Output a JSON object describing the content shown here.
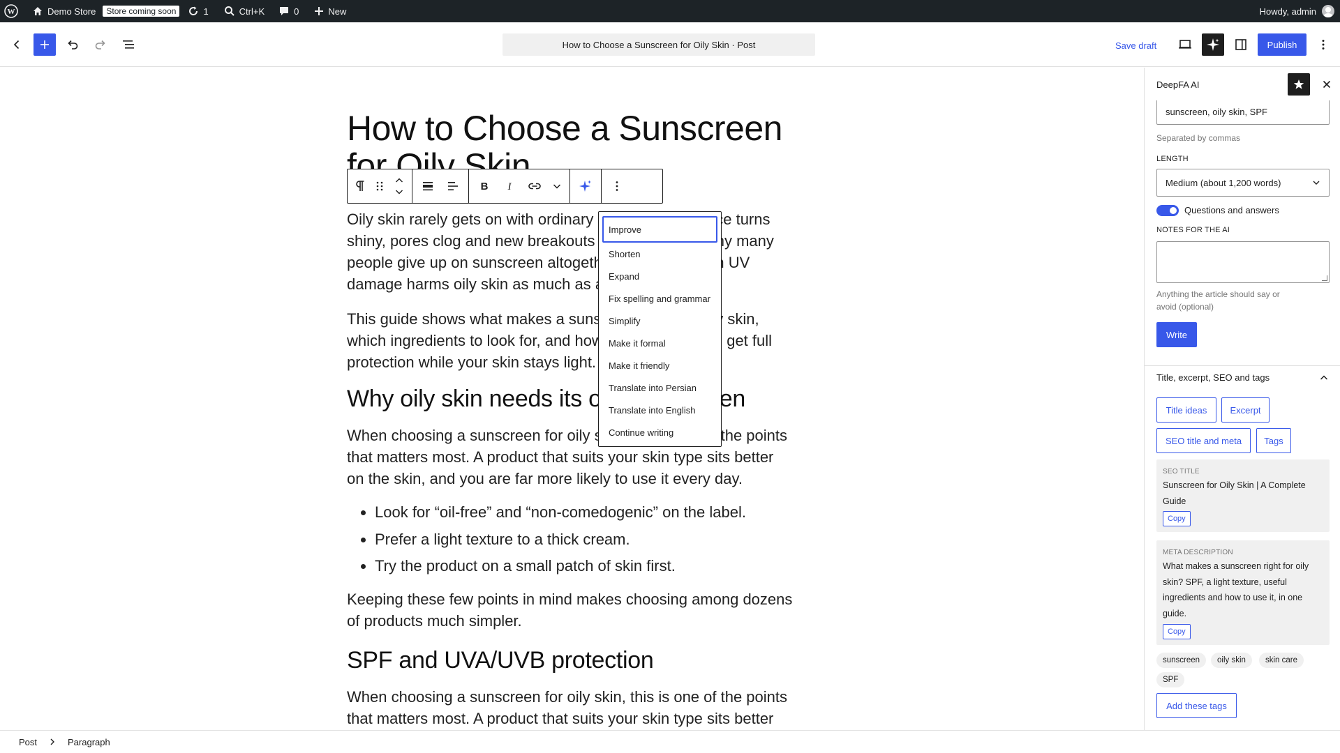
{
  "adminbar": {
    "site_name": "Demo Store",
    "store_badge": "Store coming soon",
    "updates_count": "1",
    "search_shortcut": "Ctrl+K",
    "comments_count": "0",
    "new_label": "New",
    "greeting": "Howdy, admin"
  },
  "header": {
    "document_title": "How to Choose a Sunscreen for Oily Skin · Post",
    "save_draft": "Save draft",
    "publish": "Publish"
  },
  "post": {
    "title": "How to Choose a Sunscreen for Oily Skin",
    "blocks": [
      {
        "type": "p",
        "text": "Oily skin rarely gets on with ordinary sunscreen: the face turns shiny, pores clog and new breakouts appear. That is why many people give up on sunscreen altogether — even though UV damage harms oily skin as much as any other."
      },
      {
        "type": "p",
        "text": "This guide shows what makes a sunscreen right for oily skin, which ingredients to look for, and how to apply it so you get full protection while your skin stays light."
      },
      {
        "type": "h2",
        "text": "Why oily skin needs its own sunscreen"
      },
      {
        "type": "p",
        "text": "When choosing a sunscreen for oily skin, this is one of the points that matters most. A product that suits your skin type sits better on the skin, and you are far more likely to use it every day."
      },
      {
        "type": "ul",
        "items": [
          "Look for “oil-free” and “non-comedogenic” on the label.",
          "Prefer a light texture to a thick cream.",
          "Try the product on a small patch of skin first."
        ]
      },
      {
        "type": "p",
        "text": "Keeping these few points in mind makes choosing among dozens of products much simpler."
      },
      {
        "type": "h2",
        "text": "SPF and UVA/UVB protection"
      },
      {
        "type": "p",
        "text": "When choosing a sunscreen for oily skin, this is one of the points that matters most. A product that suits your skin type sits better"
      }
    ]
  },
  "ai_menu": {
    "items": [
      "Improve",
      "Shorten",
      "Expand",
      "Fix spelling and grammar",
      "Simplify",
      "Make it formal",
      "Make it friendly",
      "Translate into Persian",
      "Translate into English",
      "Continue writing"
    ],
    "active_index": 0
  },
  "sidebar": {
    "title": "DeepFA AI",
    "keywords_value": "sunscreen, oily skin, SPF",
    "keywords_help": "Separated by commas",
    "length_label": "LENGTH",
    "length_value": "Medium (about 1,200 words)",
    "qa_toggle_label": "Questions and answers",
    "qa_toggle_on": true,
    "notes_label": "NOTES FOR THE AI",
    "notes_value": "",
    "notes_help": "Anything the article should say or avoid (optional)",
    "write_button": "Write",
    "panel_title": "Title, excerpt, SEO and tags",
    "buttons": {
      "title_ideas": "Title ideas",
      "excerpt": "Excerpt",
      "seo": "SEO title and meta",
      "tags": "Tags"
    },
    "seo_title_label": "SEO TITLE",
    "seo_title_value": "Sunscreen for Oily Skin | A Complete Guide",
    "meta_label": "META DESCRIPTION",
    "meta_value": "What makes a sunscreen right for oily skin? SPF, a light texture, useful ingredients and how to use it, in one guide.",
    "copy_label": "Copy",
    "tags": [
      "sunscreen",
      "oily skin",
      "skin care",
      "SPF"
    ],
    "add_tags_button": "Add these tags"
  },
  "footer": {
    "crumbs": [
      "Post",
      "Paragraph"
    ]
  },
  "colors": {
    "accent": "#3858e9",
    "adminbar_bg": "#1d2327",
    "text": "#1e1e1e"
  }
}
